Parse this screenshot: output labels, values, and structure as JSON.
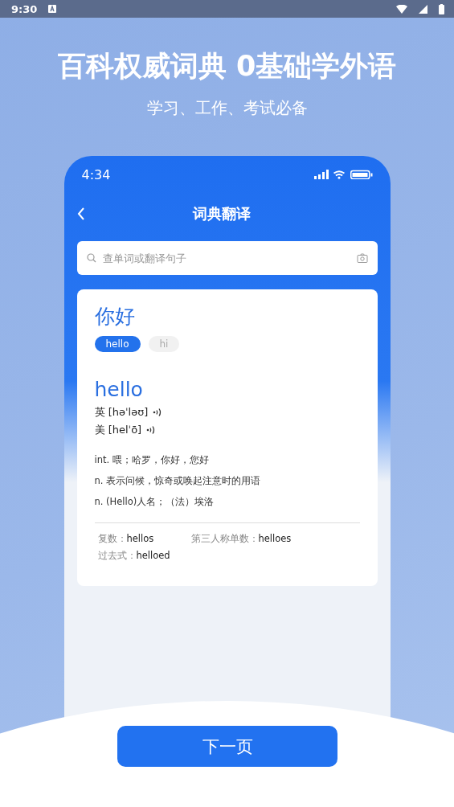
{
  "status_bar": {
    "time": "9:30"
  },
  "headline": "百科权威词典 0基础学外语",
  "subheadline": "学习、工作、考试必备",
  "phone": {
    "time": "4:34",
    "title": "词典翻译",
    "search": {
      "placeholder": "查单词或翻译句子"
    },
    "card": {
      "word": "你好",
      "chips": [
        {
          "label": "hello",
          "selected": true
        },
        {
          "label": "hi",
          "selected": false
        }
      ],
      "headword": "hello",
      "pronunciations": [
        {
          "region": "英",
          "ipa": "[həˈləʊ]"
        },
        {
          "region": "美",
          "ipa": "[helˈō]"
        }
      ],
      "definitions": [
        "int. 喂；哈罗，你好，您好",
        "n. 表示问候，惊奇或唤起注意时的用语",
        "n. (Hello)人名；（法）埃洛"
      ],
      "forms": [
        {
          "label": "复数：",
          "value": "hellos"
        },
        {
          "label": "第三人称单数：",
          "value": "helloes"
        },
        {
          "label": "过去式：",
          "value": "helloed"
        }
      ]
    }
  },
  "next_button": "下一页"
}
